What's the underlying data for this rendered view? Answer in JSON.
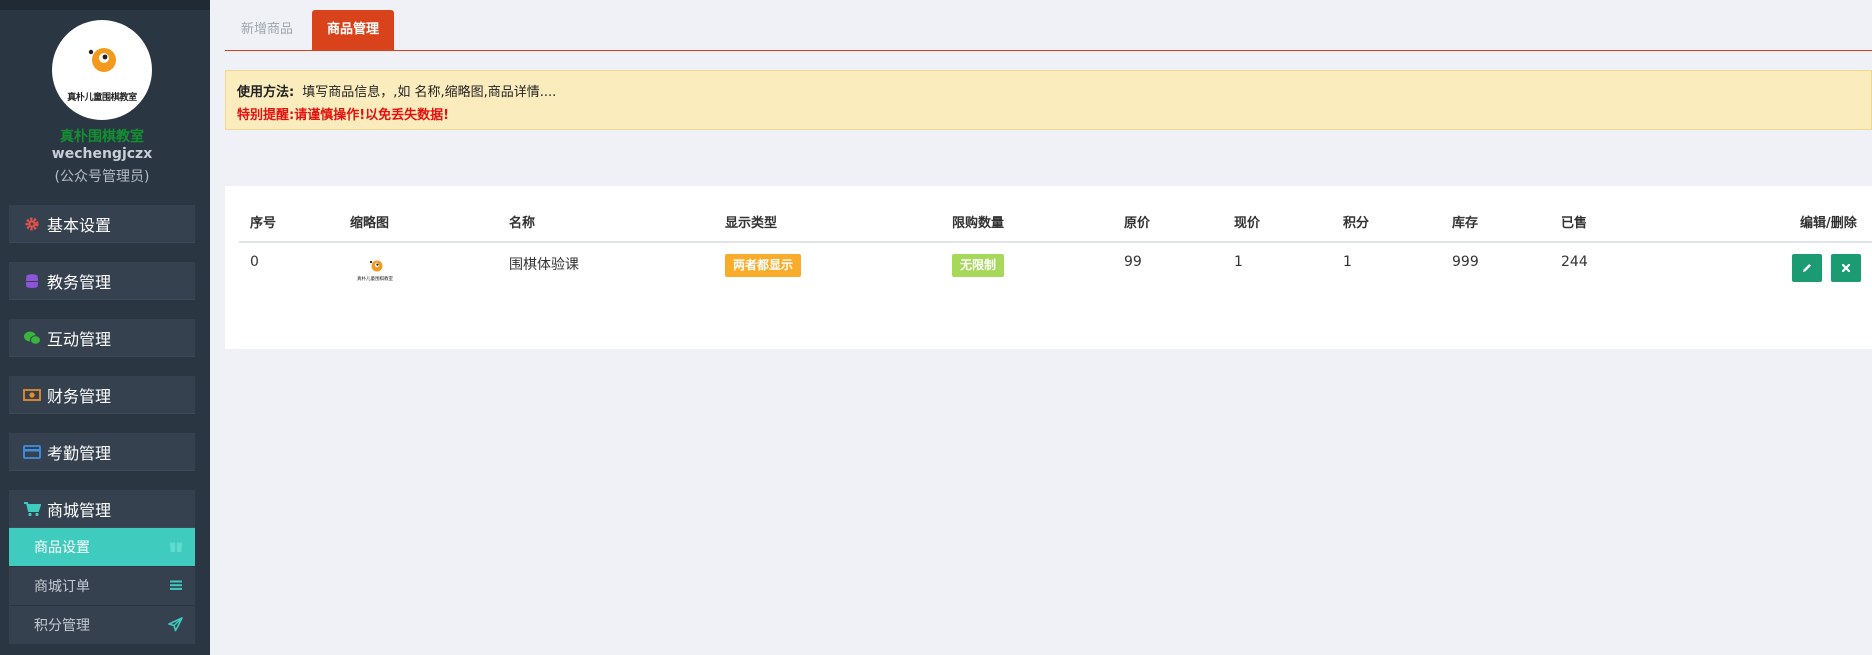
{
  "sidebar": {
    "logo_text": "真朴儿童围棋教室",
    "org_name": "真朴围棋教室",
    "user_name": "wechengjczx",
    "user_role": "(公众号管理员)",
    "menus": [
      {
        "label": "基本设置",
        "icon": "gear-icon",
        "color": "#e5514b"
      },
      {
        "label": "教务管理",
        "icon": "database-icon",
        "color": "#8b55d9"
      },
      {
        "label": "互动管理",
        "icon": "wechat-icon",
        "color": "#38b53a"
      },
      {
        "label": "财务管理",
        "icon": "money-icon",
        "color": "#e58b2c"
      },
      {
        "label": "考勤管理",
        "icon": "credit-card-icon",
        "color": "#3f8fe0"
      },
      {
        "label": "商城管理",
        "icon": "cart-icon",
        "color": "#3fcbbd"
      }
    ],
    "submenus": [
      {
        "label": "商品设置",
        "icon": "gift-icon",
        "active": true
      },
      {
        "label": "商城订单",
        "icon": "list-icon",
        "active": false
      },
      {
        "label": "积分管理",
        "icon": "paper-plane-icon",
        "active": false
      }
    ]
  },
  "tabs": {
    "new_product": "新增商品",
    "product_manage": "商品管理"
  },
  "notice": {
    "label": "使用方法:",
    "text": "填写商品信息，,如 名称,缩略图,商品详情....",
    "warning": "特别提醒:请谨慎操作!以免丢失数据!"
  },
  "table": {
    "headers": [
      "序号",
      "缩略图",
      "名称",
      "显示类型",
      "限购数量",
      "原价",
      "现价",
      "积分",
      "库存",
      "已售",
      "编辑/删除"
    ],
    "rows": [
      {
        "index": "0",
        "thumbnail_text": "真朴儿童围棋教室",
        "name": "围棋体验课",
        "display_type": "两者都显示",
        "limit": "无限制",
        "original_price": "99",
        "current_price": "1",
        "points": "1",
        "stock": "999",
        "sold": "244"
      }
    ]
  },
  "colors": {
    "sidebar_bg": "#2b3643",
    "accent_teal": "#3fcbbd",
    "tab_active": "#d9431b",
    "warning_red": "#e5120f",
    "badge_orange": "#f8ac2a",
    "badge_green": "#a6d95a",
    "action_green": "#1a9b72"
  }
}
